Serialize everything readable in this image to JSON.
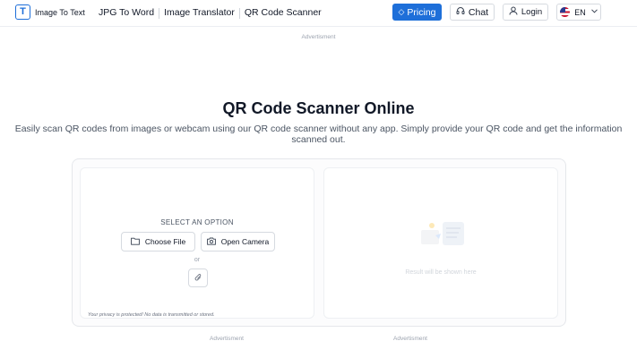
{
  "header": {
    "logo_text": "Image To Text",
    "logo_mark": "T",
    "nav": [
      "JPG To Word",
      "Image Translator",
      "QR Code Scanner"
    ],
    "pricing_label": "Pricing",
    "chat_label": "Chat",
    "login_label": "Login",
    "lang_label": "EN"
  },
  "ads": {
    "top": "Advertisment",
    "bottom_left": "Advertisment",
    "bottom_right": "Advertisment"
  },
  "main": {
    "title": "QR Code Scanner Online",
    "subtitle": "Easily scan QR codes from images or webcam using our QR code scanner without any app. Simply provide your QR code and get the information scanned out."
  },
  "upload": {
    "select_label": "SELECT AN OPTION",
    "choose_file_label": "Choose File",
    "open_camera_label": "Open Camera",
    "or_text": "or",
    "privacy_text": "Your privacy is protected! No data is transmitted or stored."
  },
  "result": {
    "placeholder": "Result will be shown here"
  },
  "icons": {
    "logo": "logo-icon",
    "pricing": "diamond-icon",
    "chat": "headset-icon",
    "login": "user-icon",
    "lang": "us-flag-icon",
    "dropdown": "chevron-down-icon",
    "choose_file": "folder-icon",
    "open_camera": "camera-icon",
    "paste": "paperclip-icon",
    "result": "result-illustration-icon"
  },
  "colors": {
    "brand": "#1e6fd9",
    "border": "#e5e7eb",
    "muted": "#9ca3af"
  }
}
